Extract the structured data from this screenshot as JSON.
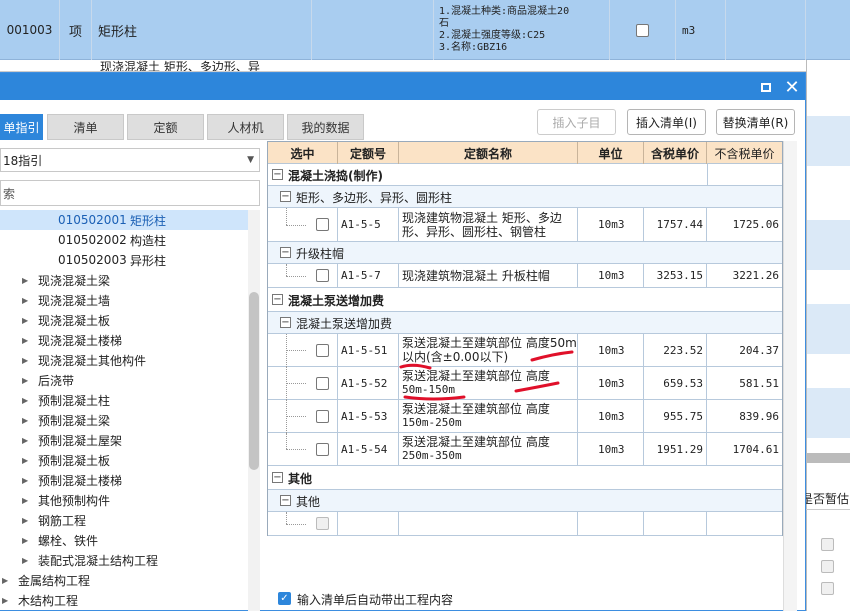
{
  "background": {
    "row_code": "001003",
    "row_type": "项",
    "row_name": "矩形柱",
    "row_features": [
      "1.混凝土种类:商品混凝土20",
      "石",
      "2.混凝土强度等级:C25",
      "3.名称:GBZ16"
    ],
    "row_unit": "m3",
    "row2_name": "现浇混凝土 矩形、多边形、异",
    "right_header": "是否暂估"
  },
  "dialog": {
    "tabs": [
      "单指引",
      "清单",
      "定额",
      "人材机",
      "我的数据"
    ],
    "buttons": {
      "insert_child": "插入子目",
      "insert_list": "插入清单(I)",
      "replace_list": "替换清单(R)"
    },
    "dropdown_value": "18指引",
    "search_placeholder": "索",
    "tree": [
      {
        "code": "010502001",
        "label": "矩形柱",
        "selected": true
      },
      {
        "code": "010502002",
        "label": "构造柱"
      },
      {
        "code": "010502003",
        "label": "异形柱"
      },
      {
        "label": "现浇混凝土梁"
      },
      {
        "label": "现浇混凝土墙"
      },
      {
        "label": "现浇混凝土板"
      },
      {
        "label": "现浇混凝土楼梯"
      },
      {
        "label": "现浇混凝土其他构件"
      },
      {
        "label": "后浇带"
      },
      {
        "label": "预制混凝土柱"
      },
      {
        "label": "预制混凝土梁"
      },
      {
        "label": "预制混凝土屋架"
      },
      {
        "label": "预制混凝土板"
      },
      {
        "label": "预制混凝土楼梯"
      },
      {
        "label": "其他预制构件"
      },
      {
        "label": "钢筋工程"
      },
      {
        "label": "螺栓、铁件"
      },
      {
        "label": "装配式混凝土结构工程"
      },
      {
        "label": "金属结构工程"
      },
      {
        "label": "木结构工程"
      }
    ],
    "grid": {
      "headers": [
        "选中",
        "定额号",
        "定额名称",
        "单位",
        "含税单价",
        "不含税单价"
      ],
      "groups": [
        {
          "title": "混凝土浇捣(制作)"
        },
        {
          "title": "矩形、多边形、异形、圆形柱"
        },
        {
          "code": "A1-5-5",
          "name1": "现浇建筑物混凝土 矩形、多边",
          "name2": "形、异形、圆形柱、钢管柱",
          "unit": "10m3",
          "tax": "1757.44",
          "notax": "1725.06"
        },
        {
          "title": "升级柱帽"
        },
        {
          "code": "A1-5-7",
          "name1": "现浇建筑物混凝土 升板柱帽",
          "name2": "",
          "unit": "10m3",
          "tax": "3253.15",
          "notax": "3221.26"
        },
        {
          "title": "混凝土泵送增加费"
        },
        {
          "title": "混凝土泵送增加费"
        },
        {
          "code": "A1-5-51",
          "name1": "泵送混凝土至建筑部位 高度50m",
          "name2": "以内(含±0.00以下)",
          "unit": "10m3",
          "tax": "223.52",
          "notax": "204.37"
        },
        {
          "code": "A1-5-52",
          "name1": "泵送混凝土至建筑部位 高度",
          "name2": "50m-150m",
          "unit": "10m3",
          "tax": "659.53",
          "notax": "581.51"
        },
        {
          "code": "A1-5-53",
          "name1": "泵送混凝土至建筑部位 高度",
          "name2": "150m-250m",
          "unit": "10m3",
          "tax": "955.75",
          "notax": "839.96"
        },
        {
          "code": "A1-5-54",
          "name1": "泵送混凝土至建筑部位 高度",
          "name2": "250m-350m",
          "unit": "10m3",
          "tax": "1951.29",
          "notax": "1704.61"
        },
        {
          "title": "其他"
        },
        {
          "title": "其他"
        }
      ]
    },
    "footer_label": "输入清单后自动带出工程内容"
  },
  "colors": {
    "accent": "#2d86db",
    "header": "#fbe3c6",
    "annotation": "#e0102a"
  }
}
